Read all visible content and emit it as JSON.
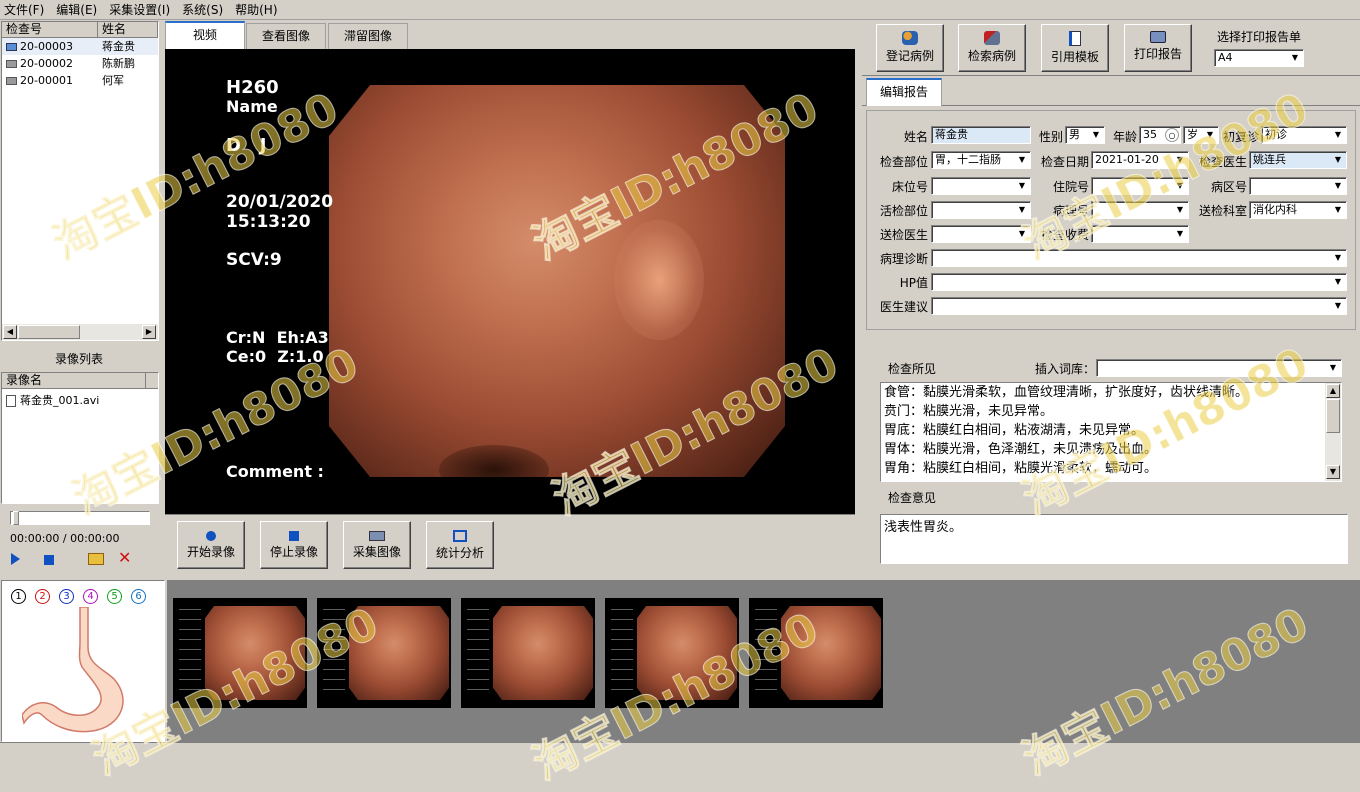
{
  "menu": [
    "文件(F)",
    "编辑(E)",
    "采集设置(I)",
    "系统(S)",
    "帮助(H)"
  ],
  "patient_list": {
    "headers": [
      "检查号",
      "姓名"
    ],
    "rows": [
      {
        "id": "20-00003",
        "name": "蒋金贵",
        "color": "#5a8fd8"
      },
      {
        "id": "20-00002",
        "name": "陈新鹏",
        "color": "#9a9a9a"
      },
      {
        "id": "20-00001",
        "name": "何军",
        "color": "#9a9a9a"
      }
    ]
  },
  "recording_list": {
    "title": "录像列表",
    "header": "录像名",
    "files": [
      "蒋金贵_001.avi"
    ]
  },
  "player": {
    "time": "00:00:00 / 00:00:00"
  },
  "tabs": [
    "视频",
    "查看图像",
    "滞留图像"
  ],
  "video": {
    "model": "H260",
    "name_label": "Name",
    "dj": "D   J",
    "date": "20/01/2020",
    "time": "15:13:20",
    "scv": "SCV:9",
    "line1": "Cr:N  Eh:A3",
    "line2": "Ce:0  Z:1.0",
    "comment": "Comment :"
  },
  "video_buttons": [
    "开始录像",
    "停止录像",
    "采集图像",
    "统计分析"
  ],
  "toolbar": {
    "buttons": [
      "登记病例",
      "检索病例",
      "引用模板",
      "打印报告"
    ],
    "print_label": "选择打印报告单",
    "print_value": "A4"
  },
  "report_tab": "编辑报告",
  "form": {
    "name_label": "姓名",
    "name": "蒋金贵",
    "sex_label": "性别",
    "sex": "男",
    "age_label": "年龄",
    "age": "35",
    "age_unit": "岁",
    "visit_label": "初复诊",
    "visit": "初诊",
    "part_label": "检查部位",
    "part": "胃，十二指肠",
    "date_label": "检查日期",
    "date": "2021-01-20",
    "doctor_label": "检查医生",
    "doctor": "姚连兵",
    "bed_label": "床位号",
    "bed": "",
    "inpatient_label": "住院号",
    "inpatient": "",
    "ward_label": "病区号",
    "ward": "",
    "biopsy_label": "活检部位",
    "biopsy": "",
    "pathno_label": "病理号",
    "pathno": "",
    "dept_label": "送检科室",
    "dept": "消化内科",
    "senddoc_label": "送检医生",
    "senddoc": "",
    "fee_label": "检查收费",
    "fee": "",
    "pathdiag_label": "病理诊断",
    "pathdiag": "",
    "hp_label": "HP值",
    "hp": "",
    "advice_label": "医生建议",
    "advice": ""
  },
  "findings": {
    "label": "检查所见",
    "lexicon_label": "插入词库：",
    "lines": [
      "食管：黏膜光滑柔软，血管纹理清晰，扩张度好，齿状线清晰。",
      "贲门：粘膜光滑，未见异常。",
      "胃底：粘膜红白相间，粘液湖清，未见异常。",
      "胃体：粘膜光滑，色泽潮红，未见溃疡及出血。",
      "胃角：粘膜红白相间，粘膜光滑柔软，蠕动可。"
    ]
  },
  "opinion": {
    "label": "检查意见",
    "text": "浅表性胃炎。"
  },
  "stomach_markers": [
    "1",
    "2",
    "3",
    "4",
    "5",
    "6"
  ],
  "marker_colors": [
    "#000000",
    "#d01010",
    "#1030c0",
    "#b010c0",
    "#10a020",
    "#1070c0"
  ],
  "watermark": "淘宝ID:h8080"
}
